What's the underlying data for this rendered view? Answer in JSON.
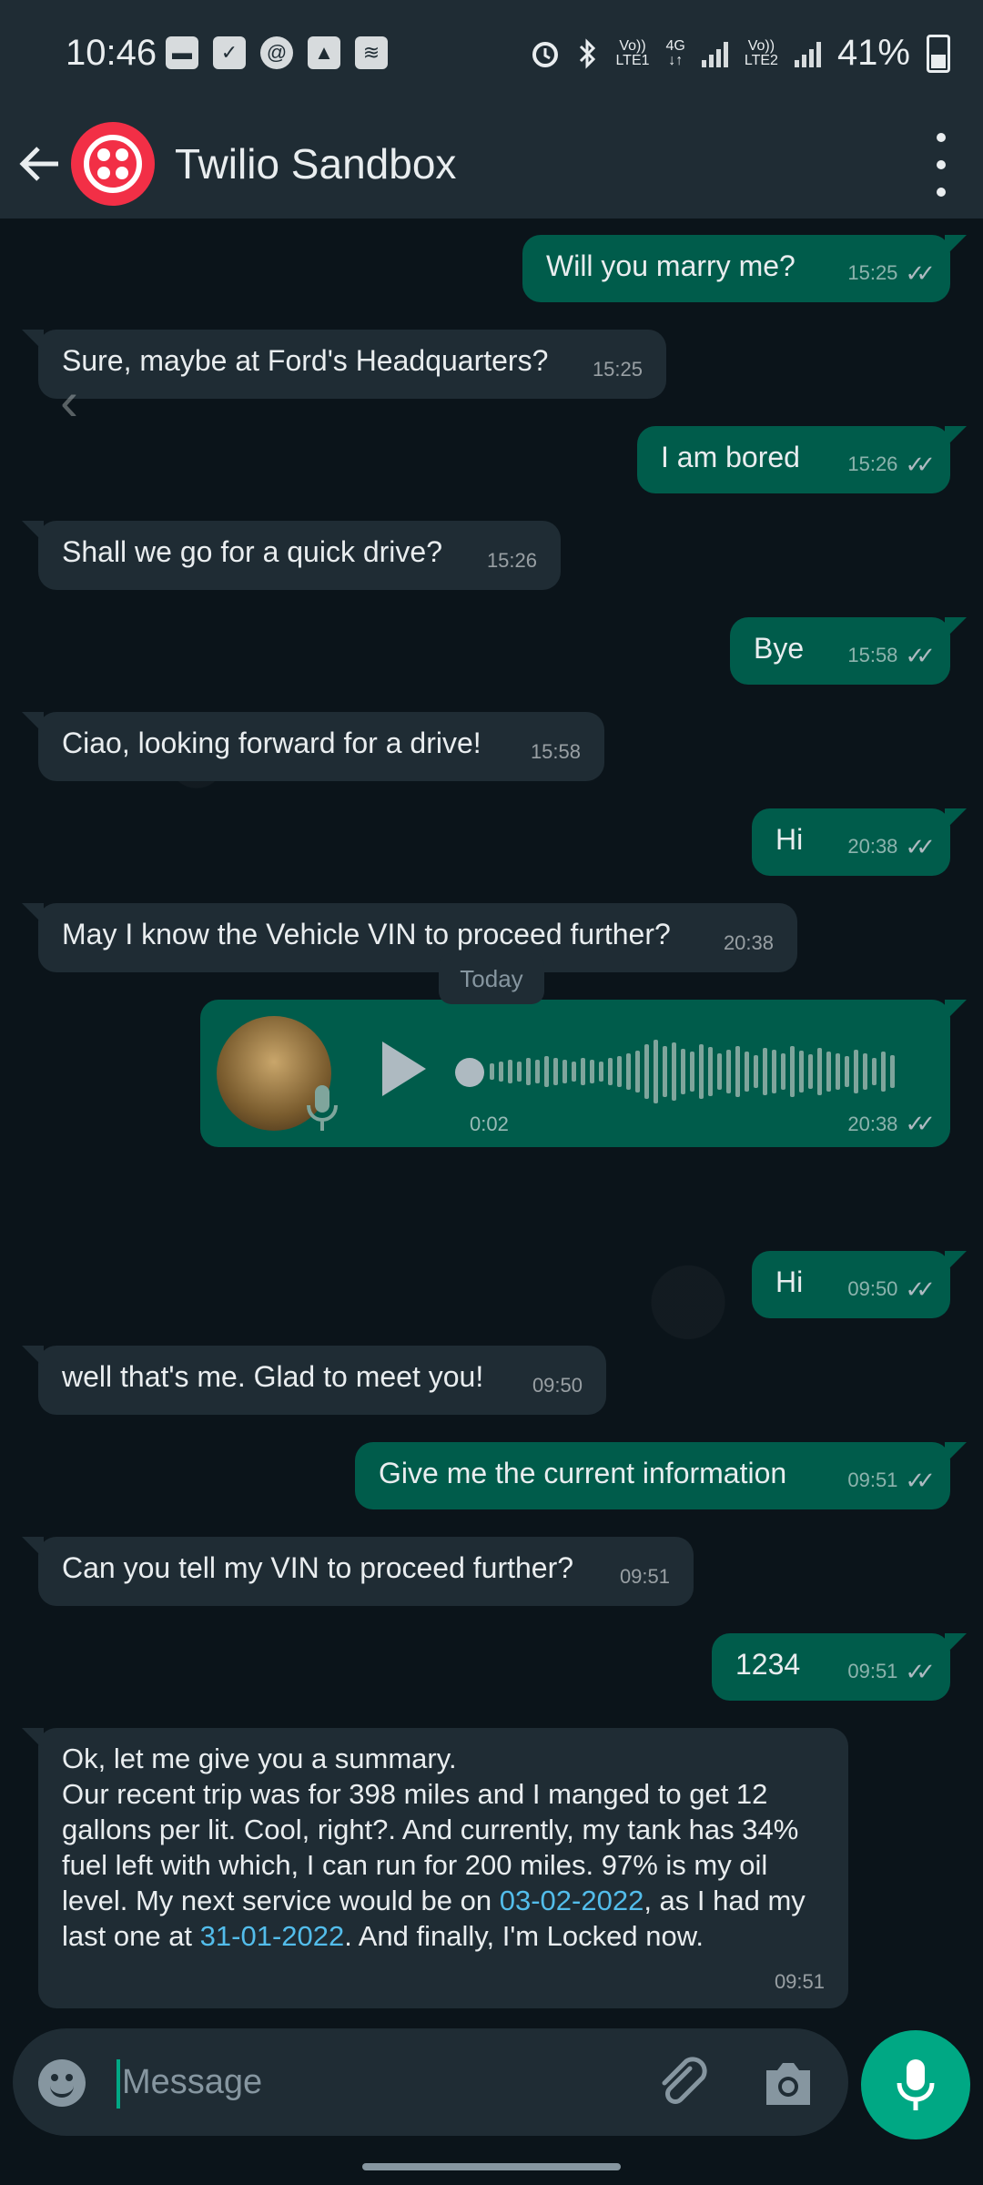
{
  "status_bar": {
    "time": "10:46",
    "battery": "41%",
    "sim1": "LTE1",
    "sim2": "LTE2",
    "net": "4G",
    "volte": "Vo))"
  },
  "header": {
    "title": "Twilio Sandbox"
  },
  "messages": [
    {
      "dir": "out",
      "text": "Will you marry me?",
      "time": "15:25"
    },
    {
      "dir": "in",
      "text": "Sure, maybe at Ford's Headquarters?",
      "time": "15:25"
    },
    {
      "dir": "out",
      "text": "I am bored",
      "time": "15:26"
    },
    {
      "dir": "in",
      "text": "Shall we go for a quick drive?",
      "time": "15:26"
    },
    {
      "dir": "out",
      "text": "Bye",
      "time": "15:58"
    },
    {
      "dir": "in",
      "text": "Ciao, looking forward for a drive!",
      "time": "15:58"
    },
    {
      "dir": "out",
      "text": "Hi",
      "time": "20:38"
    },
    {
      "dir": "in",
      "text": "May I know the Vehicle VIN to proceed further?",
      "time": "20:38"
    },
    {
      "dir": "out",
      "text": "Hi",
      "time": "09:50"
    },
    {
      "dir": "in",
      "text": "well that's me. Glad to meet you!",
      "time": "09:50"
    },
    {
      "dir": "out",
      "text": "Give me the current information",
      "time": "09:51"
    },
    {
      "dir": "in",
      "text": "Can you tell my VIN to proceed further?",
      "time": "09:51"
    },
    {
      "dir": "out",
      "text": "1234",
      "time": "09:51"
    }
  ],
  "voice_note": {
    "duration": "0:02",
    "time": "20:38"
  },
  "date_divider": "Today",
  "summary": {
    "line1": "Ok, let me give you a summary.",
    "part1": "Our recent trip was for 398 miles and I manged to get 12 gallons per lit. Cool, right?. And currently, my tank has 34% fuel left with which, I can run for 200 miles. 97% is my oil level. My next service would be on ",
    "date1": "03-02-2022",
    "part2": ", as I had my last one at ",
    "date2": "31-01-2022",
    "part3": ". And finally, I'm Locked now.",
    "time": "09:51"
  },
  "input": {
    "placeholder": "Message"
  }
}
